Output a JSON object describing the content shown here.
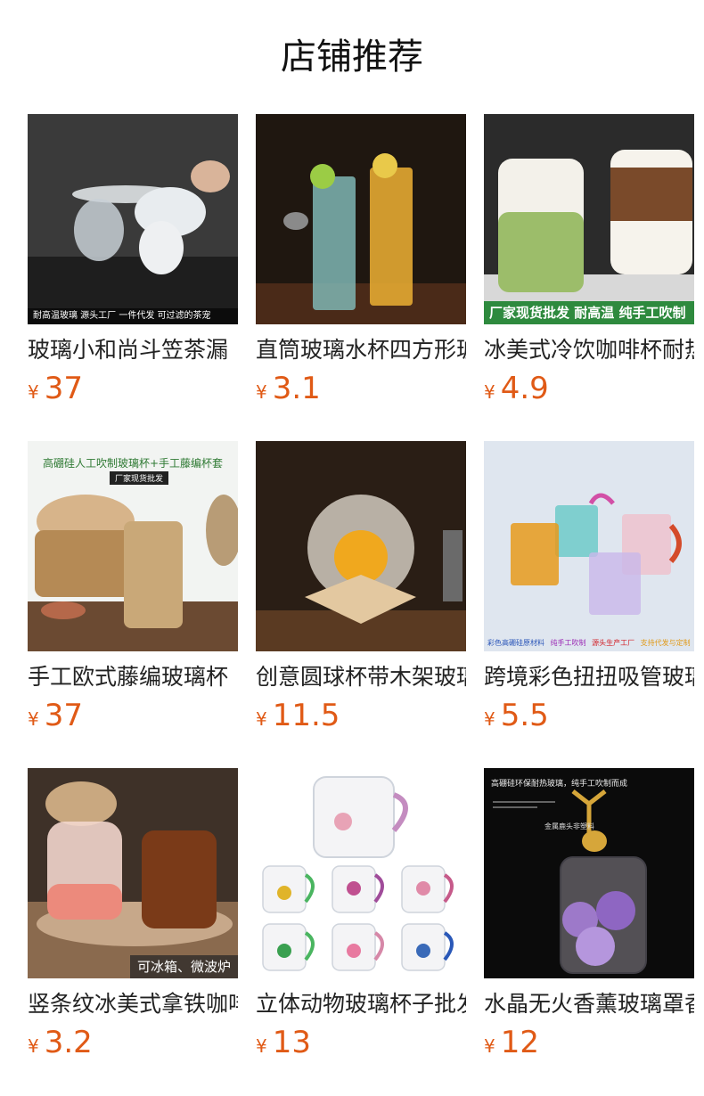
{
  "section": {
    "title": "店铺推荐"
  },
  "currency_symbol": "¥",
  "products": [
    {
      "title": "玻璃小和尚斗笠茶漏",
      "price": "37",
      "image_caption": "耐高温玻璃 源头工厂 一件代发 可过滤的茶宠"
    },
    {
      "title": "直筒玻璃水杯四方形玻",
      "price": "3.1"
    },
    {
      "title": "冰美式冷饮咖啡杯耐热",
      "price": "4.9",
      "image_caption": "厂家现货批发  耐高温  纯手工吹制"
    },
    {
      "title": "手工欧式藤编玻璃杯",
      "price": "37",
      "image_caption": "高硼硅人工吹制玻璃杯+手工藤编杯套",
      "image_badge": "厂家现货批发"
    },
    {
      "title": "创意圆球杯带木架玻璃",
      "price": "11.5"
    },
    {
      "title": "跨境彩色扭扭吸管玻璃",
      "price": "5.5",
      "image_caption_parts": [
        {
          "text": "彩色高硼硅原材料",
          "color": "#2a55b8"
        },
        {
          "text": "纯手工吹制",
          "color": "#9b2bb5"
        },
        {
          "text": "源头生产工厂",
          "color": "#d2232a"
        },
        {
          "text": "支持代发与定制",
          "color": "#e09a1a"
        }
      ]
    },
    {
      "title": "竖条纹冰美式拿铁咖啡",
      "price": "3.2",
      "image_caption": "可冰箱、微波炉"
    },
    {
      "title": "立体动物玻璃杯子批发",
      "price": "13"
    },
    {
      "title": "水晶无火香薰玻璃罩香",
      "price": "12",
      "image_caption": "高硼硅环保耐热玻璃，纯手工吹制而成",
      "image_caption_2": "金属鹿头非塑料"
    }
  ]
}
